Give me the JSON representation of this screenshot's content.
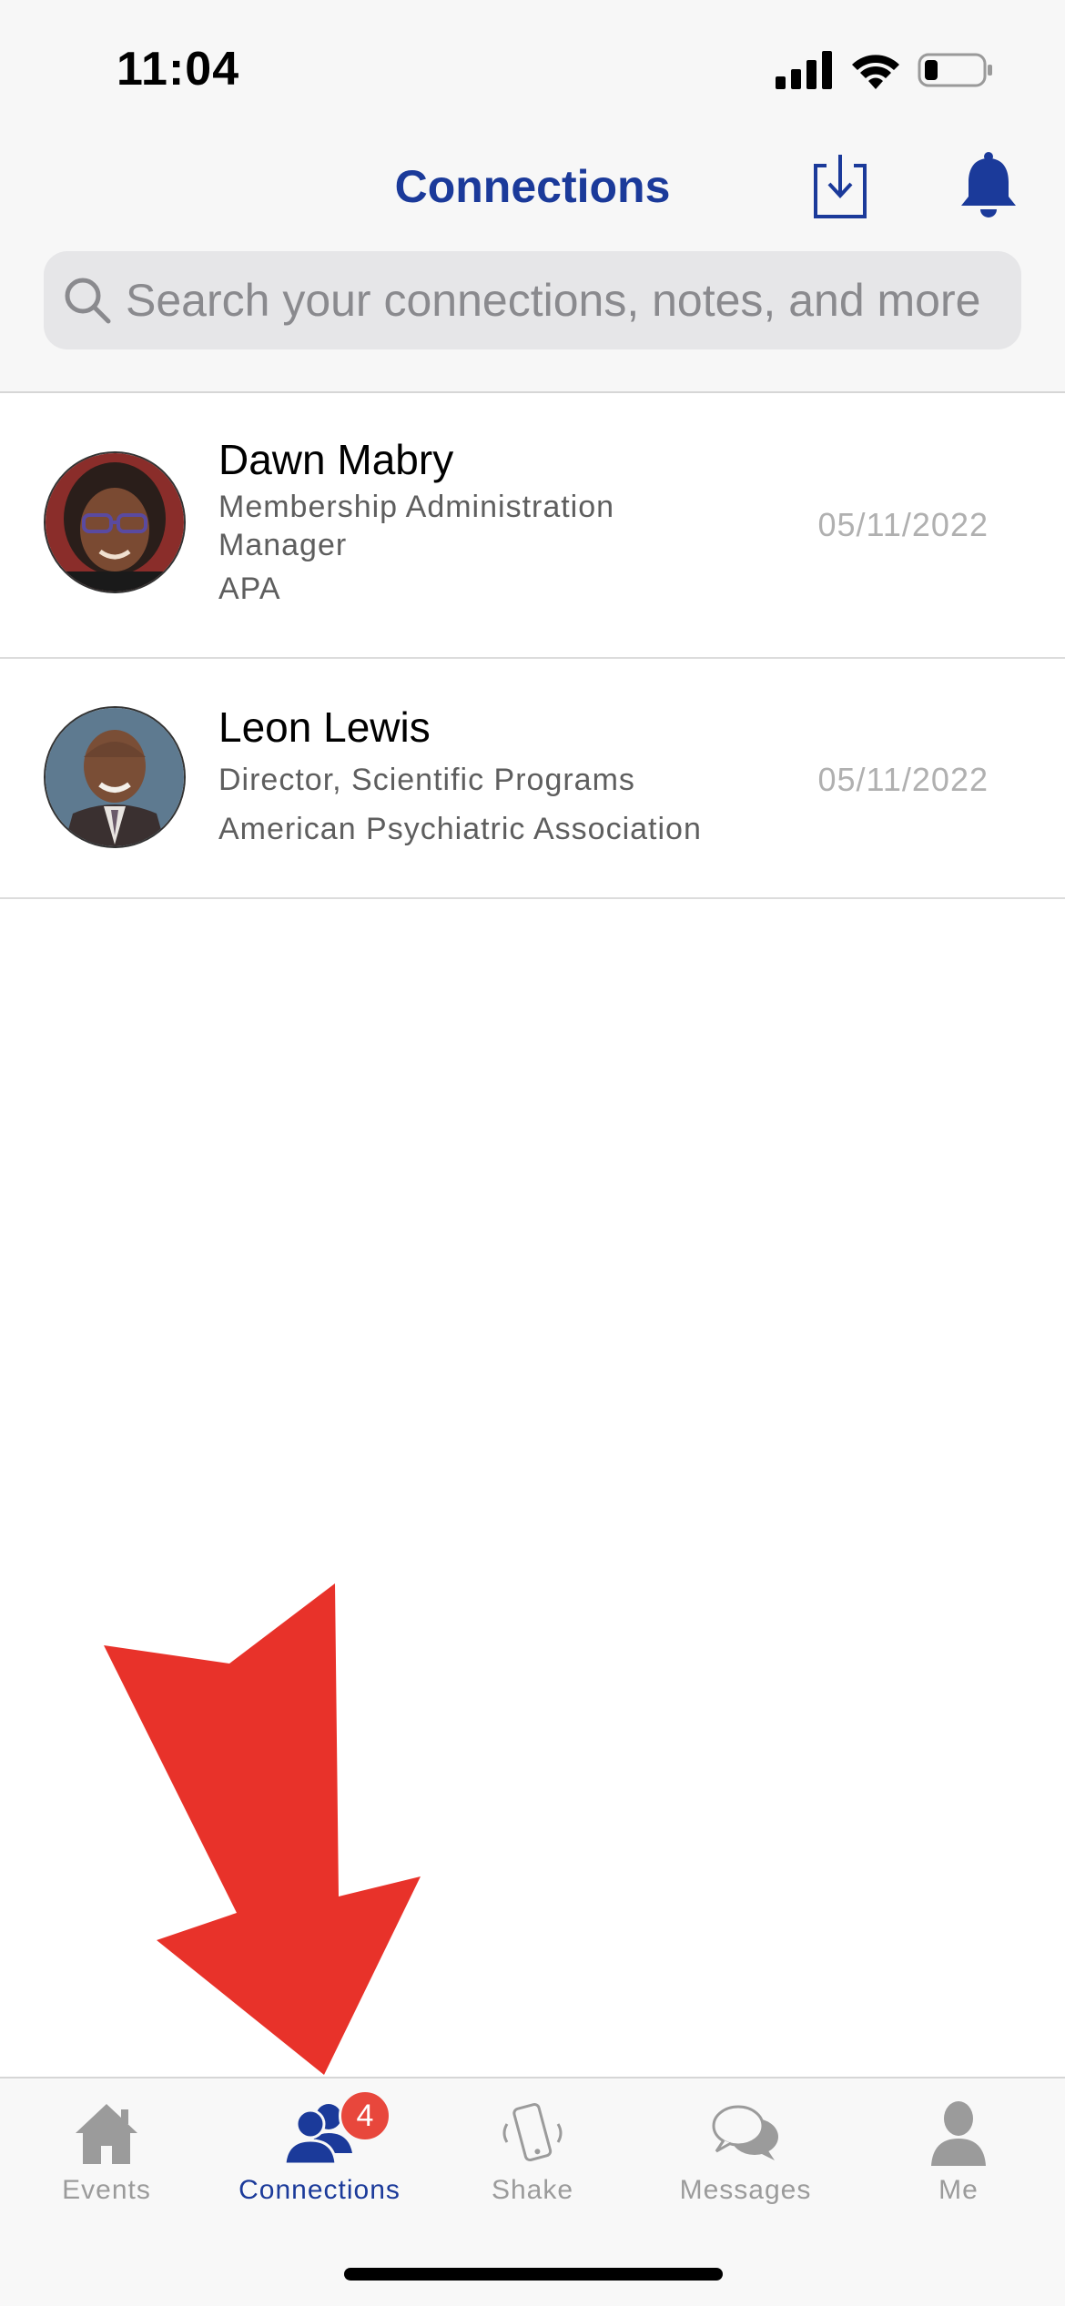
{
  "status_bar": {
    "time": "11:04"
  },
  "header": {
    "title": "Connections",
    "download_icon": "download-icon",
    "bell_icon": "bell-icon"
  },
  "search": {
    "placeholder": "Search your connections, notes, and more"
  },
  "connections": [
    {
      "name": "Dawn Mabry",
      "title": "Membership Administration Manager",
      "organization": "APA",
      "date": "05/11/2022"
    },
    {
      "name": "Leon Lewis",
      "title": "Director, Scientific Programs",
      "organization": "American Psychiatric Association",
      "date": "05/11/2022"
    }
  ],
  "tab_bar": {
    "tabs": [
      {
        "label": "Events",
        "icon": "home-icon",
        "active": false
      },
      {
        "label": "Connections",
        "icon": "people-icon",
        "active": true,
        "badge": "4"
      },
      {
        "label": "Shake",
        "icon": "phone-shake-icon",
        "active": false
      },
      {
        "label": "Messages",
        "icon": "chat-bubbles-icon",
        "active": false
      },
      {
        "label": "Me",
        "icon": "person-icon",
        "active": false
      }
    ]
  },
  "colors": {
    "accent": "#1b3a9a",
    "badge": "#e8473c",
    "annotation_arrow": "#e8322a",
    "inactive_tab": "#9b9b9b"
  }
}
